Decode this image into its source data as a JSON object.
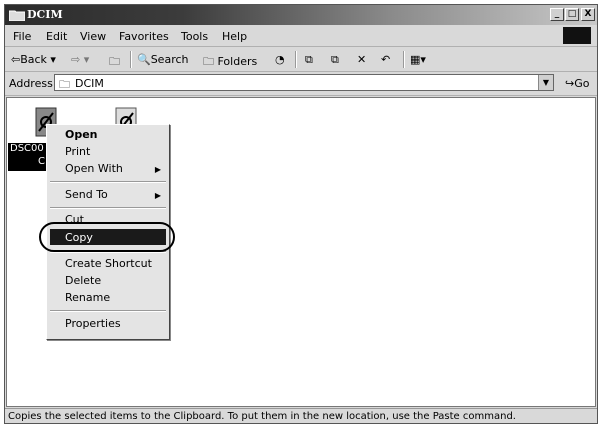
{
  "window": {
    "title": "DCIM"
  },
  "title_buttons": [
    "_",
    "□",
    "X"
  ],
  "menu": [
    "File",
    "Edit",
    "View",
    "Favorites",
    "Tools",
    "Help"
  ],
  "toolbar": {
    "back": "Back",
    "search": "Search",
    "folders": "Folders"
  },
  "address": {
    "label": "Address",
    "value": "DCIM",
    "go": "Go"
  },
  "files": [
    {
      "label": "DSC00",
      "label2": "C"
    },
    {
      "label": ""
    }
  ],
  "context_menu": [
    {
      "label": "Open",
      "bold": true
    },
    {
      "label": "Print"
    },
    {
      "label": "Open With",
      "submenu": true
    },
    {
      "label": "Send To",
      "submenu": true
    },
    {
      "label": "Cut"
    },
    {
      "label": "Copy",
      "highlighted": true
    },
    {
      "label": "Create Shortcut"
    },
    {
      "label": "Delete"
    },
    {
      "label": "Rename"
    },
    {
      "label": "Properties"
    }
  ],
  "status": "Copies the selected items to the Clipboard. To put them in the new location, use the Paste command."
}
